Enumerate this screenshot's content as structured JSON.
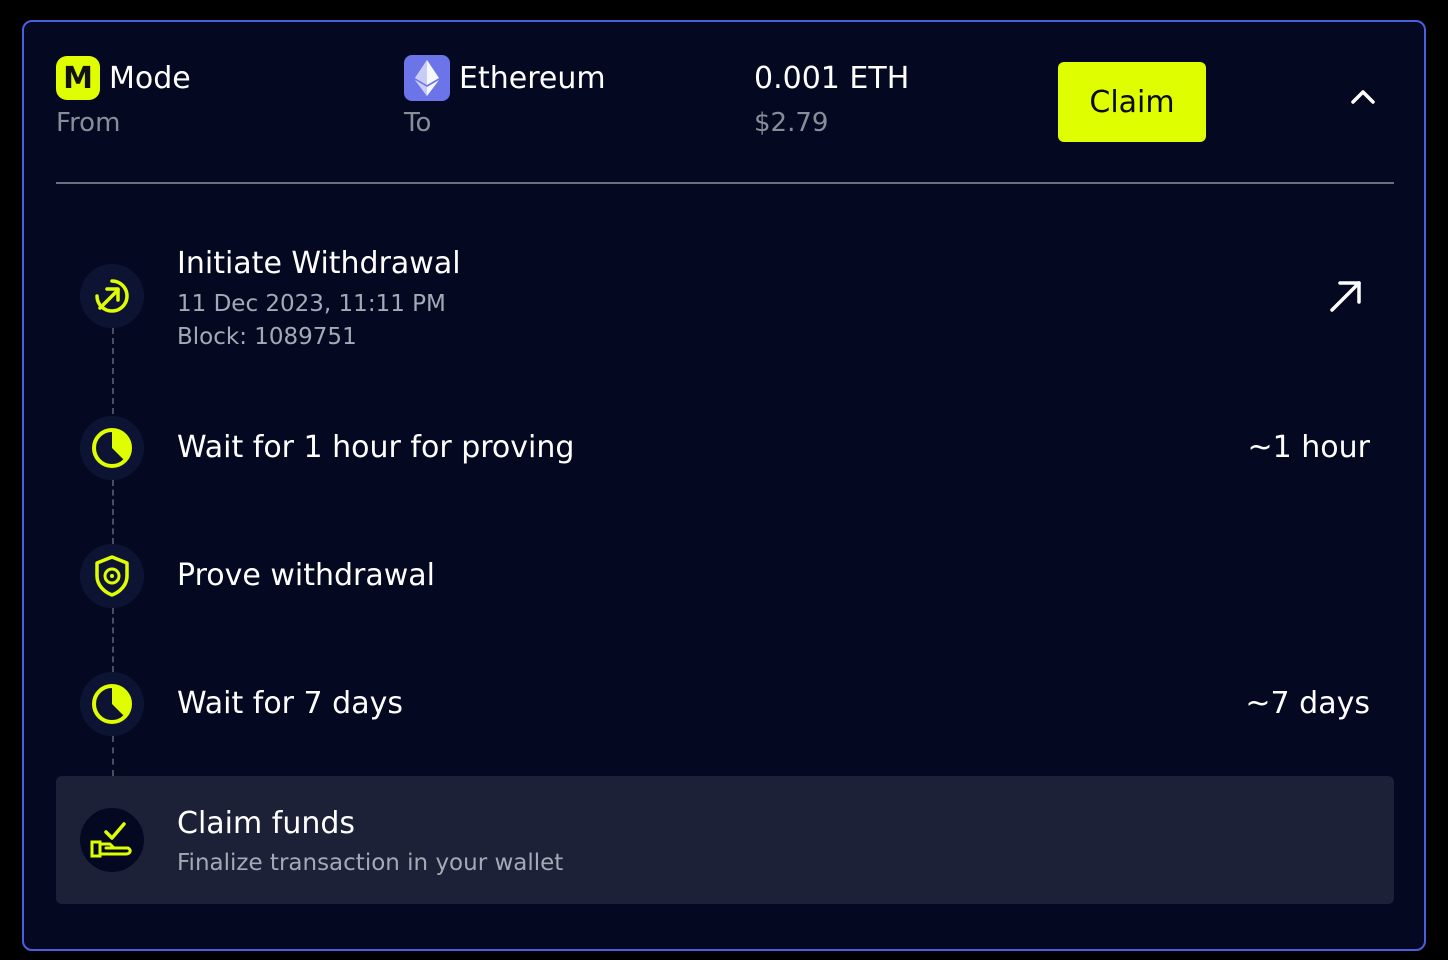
{
  "transfer": {
    "from": {
      "chain": "Mode",
      "label": "From",
      "logo_letter": "M"
    },
    "to": {
      "chain": "Ethereum",
      "label": "To"
    },
    "amount": "0.001 ETH",
    "amount_usd": "$2.79",
    "claim_label": "Claim"
  },
  "steps": [
    {
      "title": "Initiate Withdrawal",
      "date": "11 Dec 2023, 11:11 PM",
      "block": "Block: 1089751",
      "icon": "arrow-up-right-circle-icon",
      "action_icon": "external-link-icon"
    },
    {
      "title": "Wait for 1 hour for proving",
      "right": "~1 hour",
      "icon": "clock-icon"
    },
    {
      "title": "Prove withdrawal",
      "icon": "shield-icon"
    },
    {
      "title": "Wait for 7 days",
      "right": "~7 days",
      "icon": "clock-icon"
    },
    {
      "title": "Claim funds",
      "subtitle": "Finalize transaction in your wallet",
      "icon": "hand-check-icon"
    }
  ],
  "colors": {
    "accent": "#dffe00",
    "background": "#040921",
    "border": "#4a5fe0",
    "muted_text": "#8a8d99",
    "highlight_row": "#1c2138"
  }
}
